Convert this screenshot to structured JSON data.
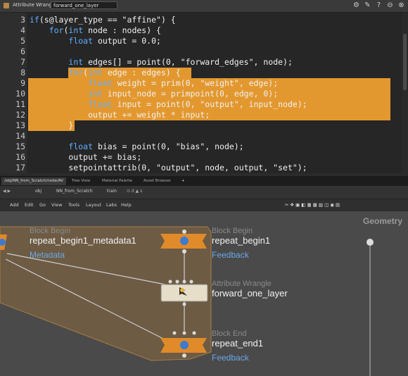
{
  "window": {
    "title": "Attribute Wrangle",
    "node_name": "forward_one_layer"
  },
  "code_lines": [
    {
      "n": "3",
      "text": "if(s@layer_type == \"affine\") {"
    },
    {
      "n": "4",
      "text": "    for(int node : nodes) {"
    },
    {
      "n": "5",
      "text": "        float output = 0.0;"
    },
    {
      "n": "6",
      "text": ""
    },
    {
      "n": "7",
      "text": "        int edges[] = point(0, \"forward_edges\", node);"
    },
    {
      "n": "8",
      "text": "        for(int edge : edges) {"
    },
    {
      "n": "9",
      "text": "            float weight = prim(0, \"weight\", edge);"
    },
    {
      "n": "10",
      "text": "            int input_node = primpoint(0, edge, 0);"
    },
    {
      "n": "11",
      "text": "            float input = point(0, \"output\", input_node);"
    },
    {
      "n": "12",
      "text": "            output += weight * input;"
    },
    {
      "n": "13",
      "text": "        }"
    },
    {
      "n": "14",
      "text": ""
    },
    {
      "n": "15",
      "text": "        float bias = point(0, \"bias\", node);"
    },
    {
      "n": "16",
      "text": "        output += bias;"
    },
    {
      "n": "17",
      "text": "        setpointattrib(0, \"output\", node, output, \"set\");"
    }
  ],
  "tabs": [
    "/obj/NN_from_Scratch/node/AV",
    "Tree View",
    "Material Palette",
    "Asset Browser"
  ],
  "path": [
    "obj",
    "NN_from_Scratch",
    "train"
  ],
  "menu": [
    "Add",
    "Edit",
    "Go",
    "View",
    "Tools",
    "Layout",
    "Labs",
    "Help"
  ],
  "nodes": {
    "meta": {
      "type": "Block Begin",
      "name": "repeat_begin1_metadata1",
      "tag": "Metadata"
    },
    "begin": {
      "type": "Block Begin",
      "name": "repeat_begin1",
      "tag": "Feedback"
    },
    "wrangle": {
      "type": "Attribute Wrangle",
      "name": "forward_one_layer"
    },
    "end": {
      "type": "Block End",
      "name": "repeat_end1",
      "tag": "Feedback"
    },
    "geometry": {
      "name": "Geometry"
    }
  },
  "colors": {
    "highlight": "#e3982f",
    "node_orange": "#e08a2a",
    "tag_blue": "#6aa8e8"
  }
}
